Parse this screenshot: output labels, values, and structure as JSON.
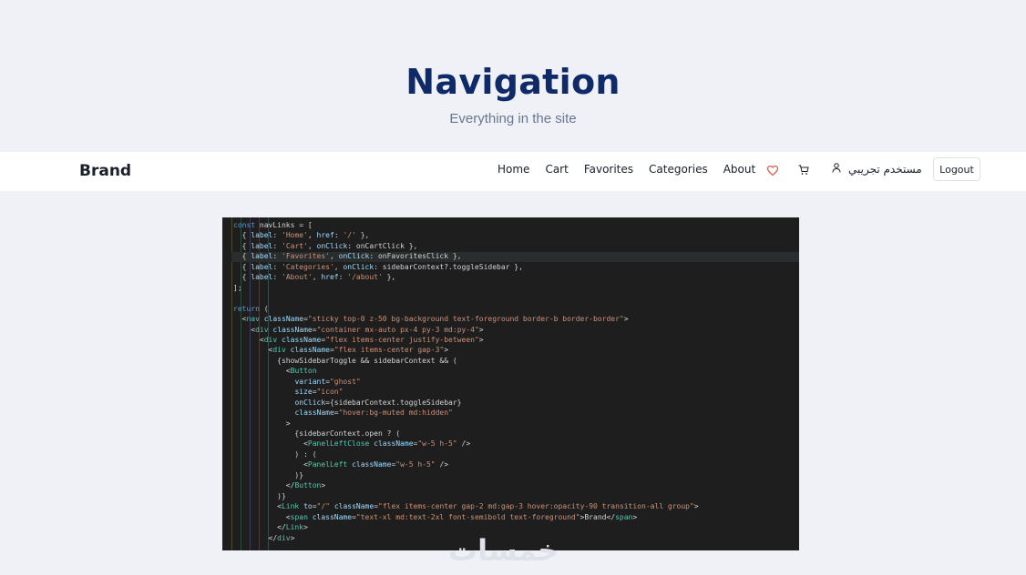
{
  "hero": {
    "title": "Navigation",
    "subtitle": "Everything in the site"
  },
  "navbar": {
    "brand": "Brand",
    "links": [
      "Home",
      "Cart",
      "Favorites",
      "Categories",
      "About"
    ],
    "user_name": "مستخدم تجريبي",
    "logout_label": "Logout",
    "icons": [
      "heart-icon",
      "cart-icon",
      "user-icon"
    ],
    "heart_color": "#e05a4f"
  },
  "code_screenshot": {
    "lines": [
      "const navLinks = [",
      "  { label: 'Home', href: '/' },",
      "  { label: 'Cart', onClick: onCartClick },",
      "  { label: 'Favorites', onClick: onFavoritesClick },",
      "  { label: 'Categories', onClick: sidebarContext?.toggleSidebar },",
      "  { label: 'About', href: '/about' },",
      "];",
      "",
      "return (",
      "  <nav className=\"sticky top-0 z-50 bg-background text-foreground border-b border-border\">",
      "    <div className=\"container mx-auto px-4 py-3 md:py-4\">",
      "      <div className=\"flex items-center justify-between\">",
      "        <div className=\"flex items-center gap-3\">",
      "          {showSidebarToggle && sidebarContext && (",
      "            <Button",
      "              variant=\"ghost\"",
      "              size=\"icon\"",
      "              onClick={sidebarContext.toggleSidebar}",
      "              className=\"hover:bg-muted md:hidden\"",
      "            >",
      "              {sidebarContext.open ? (",
      "                <PanelLeftClose className=\"w-5 h-5\" />",
      "              ) : (",
      "                <PanelLeft className=\"w-5 h-5\" />",
      "              )}",
      "            </Button>",
      "          )}",
      "          <Link to=\"/\" className=\"flex items-center gap-2 md:gap-3 hover:opacity-90 transition-all group\">",
      "            <span className=\"text-xl md:text-2xl font-semibold text-foreground\">Brand</span>",
      "          </Link>",
      "        </div>"
    ]
  },
  "watermark": "خمسات"
}
